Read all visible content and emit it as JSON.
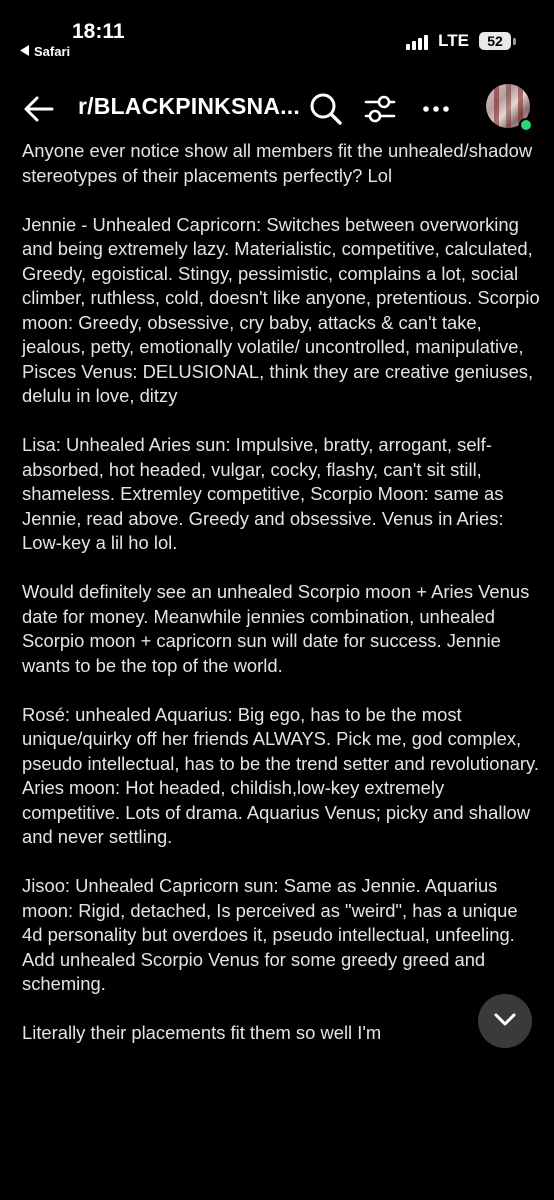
{
  "status_bar": {
    "time": "18:11",
    "back_app": "Safari",
    "network": "LTE",
    "battery": "52"
  },
  "header": {
    "title": "r/BLACKPINKSNA...",
    "icons": [
      "back-arrow-icon",
      "search-icon",
      "filter-icon",
      "more-icon"
    ]
  },
  "post": {
    "paragraphs": [
      "Anyone ever notice show all members fit the unhealed/shadow stereotypes of their placements perfectly? Lol",
      "Jennie - Unhealed Capricorn: Switches between overworking and being extremely lazy. Materialistic, competitive, calculated, Greedy, egoistical. Stingy, pessimistic, complains a lot, social climber, ruthless, cold, doesn't like anyone, pretentious. Scorpio moon: Greedy, obsessive, cry baby, attacks & can't take, jealous, petty, emotionally volatile/ uncontrolled, manipulative, Pisces Venus: DELUSIONAL, think they are creative geniuses, delulu in love, ditzy",
      "Lisa: Unhealed Aries sun: Impulsive, bratty, arrogant, self-absorbed, hot headed, vulgar, cocky, flashy, can't sit still, shameless. Extremley competitive, Scorpio Moon: same as Jennie, read above. Greedy and obsessive. Venus in Aries: Low-key a lil ho lol.",
      "Would definitely see an unhealed Scorpio moon + Aries Venus date for money. Meanwhile jennies combination, unhealed Scorpio moon + capricorn sun will date for success. Jennie wants to be the top of the world.",
      "Rosé: unhealed Aquarius: Big ego, has to be the most unique/quirky off her friends ALWAYS. Pick me, god complex, pseudo intellectual, has to be the trend setter and revolutionary. Aries moon: Hot headed, childish,low-key extremely competitive. Lots of drama. Aquarius Venus; picky and shallow and never settling.",
      "Jisoo: Unhealed Capricorn sun: Same as Jennie. Aquarius moon: Rigid, detached, Is perceived as \"weird\", has a unique 4d personality but overdoes it, pseudo intellectual, unfeeling. Add unhealed Scorpio Venus for some greedy greed and scheming.",
      "Literally their placements fit them so well I'm"
    ]
  },
  "colors": {
    "background": "#000000",
    "text": "#e4e4e4",
    "online": "#2fd37a",
    "fab": "#3a3a3a"
  }
}
